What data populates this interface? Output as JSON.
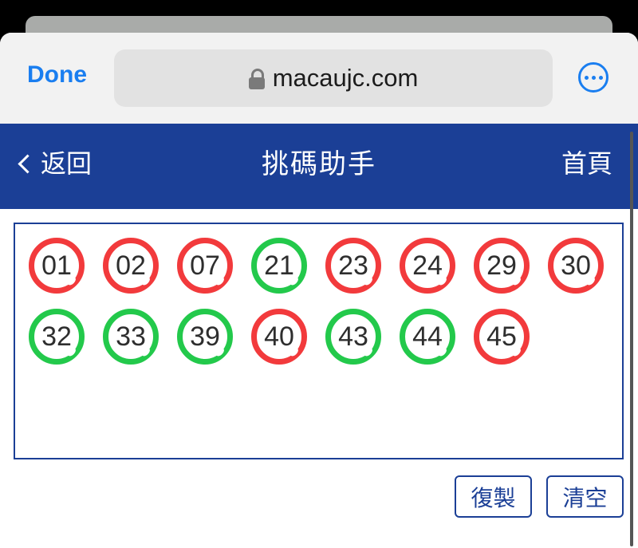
{
  "browser": {
    "done_label": "Done",
    "url": "macaujc.com"
  },
  "nav": {
    "back_label": "返回",
    "title": "挑碼助手",
    "home_label": "首頁"
  },
  "balls": [
    {
      "number": "01",
      "color": "red"
    },
    {
      "number": "02",
      "color": "red"
    },
    {
      "number": "07",
      "color": "red"
    },
    {
      "number": "21",
      "color": "green"
    },
    {
      "number": "23",
      "color": "red"
    },
    {
      "number": "24",
      "color": "red"
    },
    {
      "number": "29",
      "color": "red"
    },
    {
      "number": "30",
      "color": "red"
    },
    {
      "number": "32",
      "color": "green"
    },
    {
      "number": "33",
      "color": "green"
    },
    {
      "number": "39",
      "color": "green"
    },
    {
      "number": "40",
      "color": "red"
    },
    {
      "number": "43",
      "color": "green"
    },
    {
      "number": "44",
      "color": "green"
    },
    {
      "number": "45",
      "color": "red"
    }
  ],
  "actions": {
    "copy_label": "復製",
    "clear_label": "清空"
  },
  "colors": {
    "red": "#f23a3c",
    "green": "#23c94b",
    "nav_blue": "#1b3f96",
    "safari_blue": "#1a7ef0"
  }
}
